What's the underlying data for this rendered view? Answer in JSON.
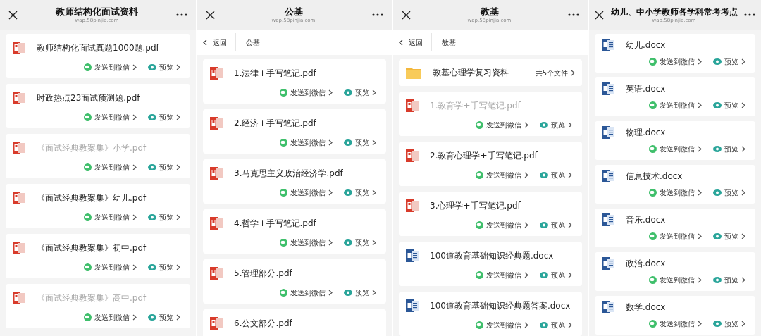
{
  "panels": [
    {
      "title": "教师结构化面试资料",
      "url": "wap.58pinjia.com",
      "items": [
        {
          "kind": "pdf",
          "name": "教师结构化面试真题1000题.pdf",
          "dimmed": false,
          "send": "发送到微信",
          "preview": "预览"
        },
        {
          "kind": "pdf",
          "name": "时政热点23面试预测题.pdf",
          "dimmed": false,
          "send": "发送到微信",
          "preview": "预览"
        },
        {
          "kind": "pdf",
          "name": "《面试经典教案集》小学.pdf",
          "dimmed": true,
          "send": "发送到微信",
          "preview": "预览"
        },
        {
          "kind": "pdf",
          "name": "《面试经典教案集》幼儿.pdf",
          "dimmed": false,
          "send": "发送到微信",
          "preview": "预览"
        },
        {
          "kind": "pdf",
          "name": "《面试经典教案集》初中.pdf",
          "dimmed": false,
          "send": "发送到微信",
          "preview": "预览"
        },
        {
          "kind": "pdf",
          "name": "《面试经典教案集》高中.pdf",
          "dimmed": true,
          "send": "发送到微信",
          "preview": "预览"
        }
      ]
    },
    {
      "title": "公基",
      "url": "wap.58pinjia.com",
      "nav": {
        "back": "返回",
        "crumb": "公基"
      },
      "items": [
        {
          "kind": "pdf",
          "name": "1.法律+手写笔记.pdf",
          "dimmed": false,
          "send": "发送到微信",
          "preview": "预览"
        },
        {
          "kind": "pdf",
          "name": "2.经济+手写笔记.pdf",
          "dimmed": false,
          "send": "发送到微信",
          "preview": "预览"
        },
        {
          "kind": "pdf",
          "name": "3.马克思主义政治经济学.pdf",
          "dimmed": false,
          "send": "发送到微信",
          "preview": "预览"
        },
        {
          "kind": "pdf",
          "name": "4.哲学+手写笔记.pdf",
          "dimmed": false,
          "send": "发送到微信",
          "preview": "预览"
        },
        {
          "kind": "pdf",
          "name": "5.管理部分.pdf",
          "dimmed": false,
          "send": "发送到微信",
          "preview": "预览"
        },
        {
          "kind": "pdf",
          "name": "6.公文部分.pdf",
          "dimmed": false
        }
      ]
    },
    {
      "title": "教基",
      "url": "wap.58pinjia.com",
      "nav": {
        "back": "返回",
        "crumb": "教基"
      },
      "items": [
        {
          "kind": "folder",
          "name": "教基心理学复习资料",
          "count": "共5个文件"
        },
        {
          "kind": "pdf",
          "name": "1.教育学+手写笔记.pdf",
          "dimmed": true,
          "send": "发送到微信",
          "preview": "预览"
        },
        {
          "kind": "pdf",
          "name": "2.教育心理学+手写笔记.pdf",
          "dimmed": false,
          "send": "发送到微信",
          "preview": "预览"
        },
        {
          "kind": "pdf",
          "name": "3.心理学+手写笔记.pdf",
          "dimmed": false,
          "send": "发送到微信",
          "preview": "预览"
        },
        {
          "kind": "word",
          "name": "100道教育基础知识经典题.docx",
          "dimmed": false,
          "send": "发送到微信",
          "preview": "预览"
        },
        {
          "kind": "word",
          "name": "100道教育基础知识经典题答案.docx",
          "dimmed": false,
          "send": "发送到微信",
          "preview": "预览"
        }
      ]
    },
    {
      "title": "幼儿、中小学教师各学科常考考点",
      "url": "wap.58pinjia.com",
      "items": [
        {
          "kind": "word",
          "name": "幼儿.docx",
          "dimmed": false,
          "send": "发送到微信",
          "preview": "预览"
        },
        {
          "kind": "word",
          "name": "英语.docx",
          "dimmed": false,
          "send": "发送到微信",
          "preview": "预览"
        },
        {
          "kind": "word",
          "name": "物理.docx",
          "dimmed": false,
          "send": "发送到微信",
          "preview": "预览"
        },
        {
          "kind": "word",
          "name": "信息技术.docx",
          "dimmed": false,
          "send": "发送到微信",
          "preview": "预览"
        },
        {
          "kind": "word",
          "name": "音乐.docx",
          "dimmed": false,
          "send": "发送到微信",
          "preview": "预览"
        },
        {
          "kind": "word",
          "name": "政治.docx",
          "dimmed": false,
          "send": "发送到微信",
          "preview": "预览"
        },
        {
          "kind": "word",
          "name": "数学.docx",
          "dimmed": false,
          "send": "发送到微信",
          "preview": "预览"
        }
      ]
    }
  ]
}
